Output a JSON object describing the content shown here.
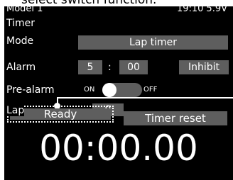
{
  "caption": "select switch function.",
  "status": {
    "model": "Model 1",
    "time": "19:10",
    "voltage": "5.9V"
  },
  "screen": {
    "title": "Timer"
  },
  "mode": {
    "label": "Mode",
    "value": "Lap timer"
  },
  "alarm": {
    "label": "Alarm",
    "minutes": "5",
    "separator": ":",
    "seconds": "00",
    "inhibit_label": "Inhibit"
  },
  "prealarm": {
    "label": "Pre-alarm",
    "on_label": "ON",
    "off_label": "OFF",
    "state": "ON"
  },
  "lap": {
    "label": "Lap",
    "value": "0"
  },
  "buttons": {
    "ready": "Ready",
    "timer_reset": "Timer reset"
  },
  "timer": {
    "display": "00:00.00"
  },
  "colors": {
    "screen_bg": "#000000",
    "field_bg": "#5e5e5e",
    "text": "#ffffff"
  }
}
